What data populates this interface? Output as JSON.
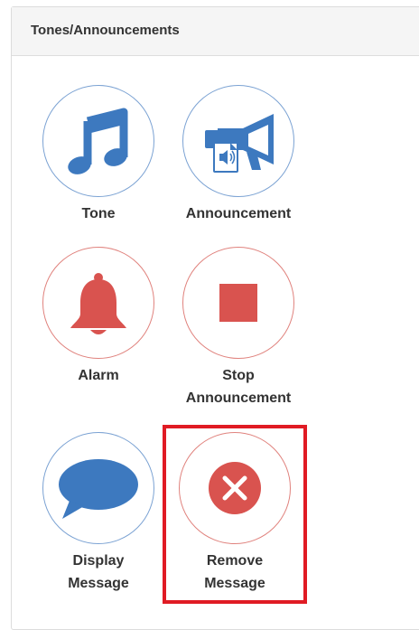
{
  "panel": {
    "title": "Tones/Announcements"
  },
  "colors": {
    "blue_icon": "#3d79bf",
    "red_icon": "#d9534f",
    "blue_border": "#7ba2d3",
    "red_border": "#e0827d",
    "highlight": "#e01b24"
  },
  "tiles": [
    {
      "name": "tone",
      "icon": "music-note-icon",
      "label_lines": [
        "Tone"
      ]
    },
    {
      "name": "announcement",
      "icon": "megaphone-icon",
      "label_lines": [
        "Announcement"
      ]
    },
    {
      "name": "alarm",
      "icon": "bell-icon",
      "label_lines": [
        "Alarm"
      ]
    },
    {
      "name": "stop-announcement",
      "icon": "stop-square-icon",
      "label_lines": [
        "Stop",
        "Announcement"
      ]
    },
    {
      "name": "display-message",
      "icon": "speech-bubble-icon",
      "label_lines": [
        "Display",
        "Message"
      ]
    },
    {
      "name": "remove-message",
      "icon": "close-circle-icon",
      "label_lines": [
        "Remove",
        "Message"
      ],
      "highlighted": true
    }
  ]
}
